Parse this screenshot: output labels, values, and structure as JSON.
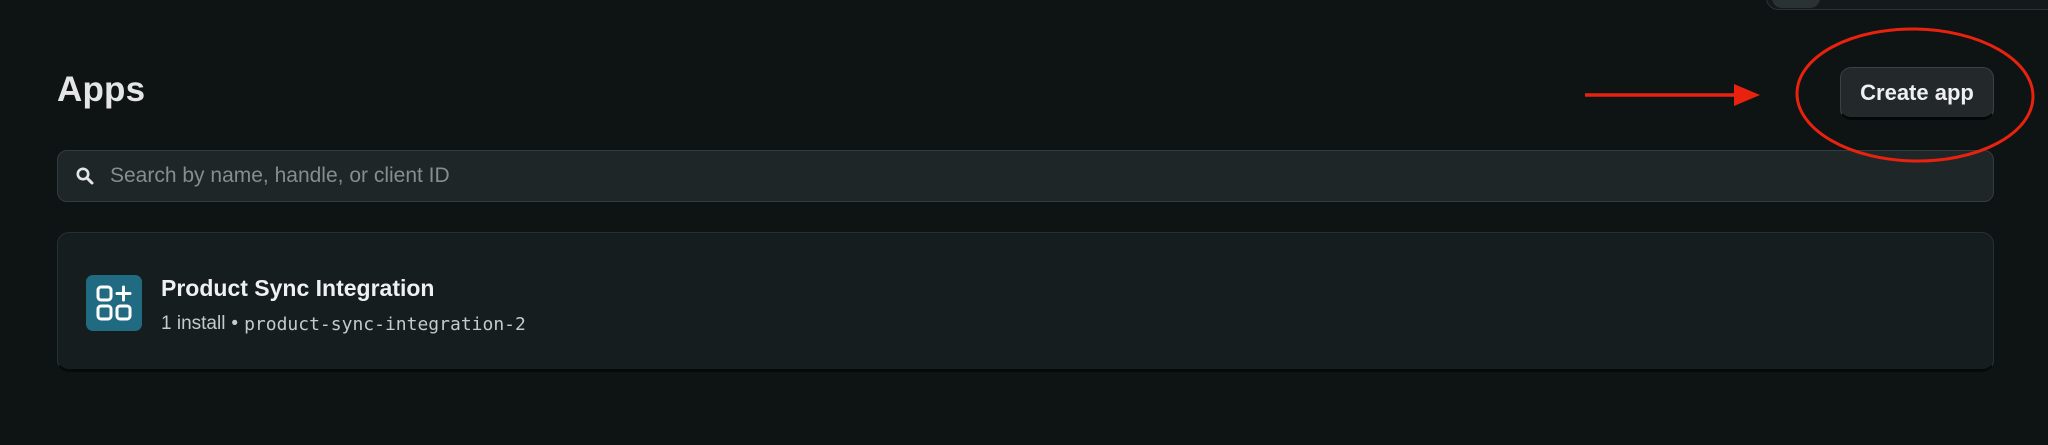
{
  "header": {
    "title": "Apps",
    "create_button_label": "Create app"
  },
  "search": {
    "placeholder": "Search by name, handle, or client ID",
    "value": ""
  },
  "apps": [
    {
      "name": "Product Sync Integration",
      "installs": "1 install",
      "separator": "•",
      "handle": "product-sync-integration-2",
      "icon": "apps-add-icon"
    }
  ],
  "colors": {
    "background": "#0e1314",
    "card": "#161d1e",
    "app_icon_bg": "#206a82",
    "annotation": "#e8220e"
  }
}
